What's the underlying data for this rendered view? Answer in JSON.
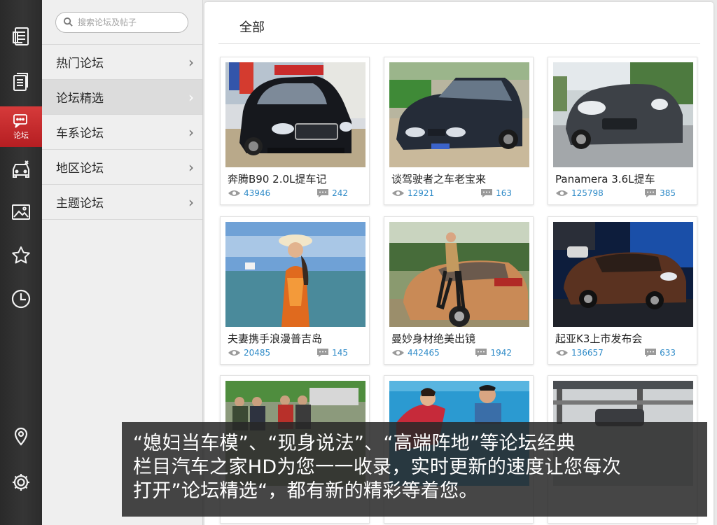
{
  "colors": {
    "accent_red": "#c8262a",
    "link_blue": "#2f8bc8",
    "rail_bg": "#303030"
  },
  "rail": [
    {
      "icon": "news-icon"
    },
    {
      "icon": "document-icon"
    },
    {
      "icon": "forum-icon",
      "label": "论坛",
      "active": true
    },
    {
      "icon": "car-icon"
    },
    {
      "icon": "picture-icon"
    },
    {
      "icon": "star-icon"
    },
    {
      "icon": "clock-icon"
    },
    {
      "icon": "location-icon"
    },
    {
      "icon": "settings-icon"
    }
  ],
  "search": {
    "placeholder": "搜索论坛及帖子"
  },
  "menu": {
    "items": [
      {
        "label": "热门论坛",
        "selected": false
      },
      {
        "label": "论坛精选",
        "selected": true
      },
      {
        "label": "车系论坛",
        "selected": false
      },
      {
        "label": "地区论坛",
        "selected": false
      },
      {
        "label": "主题论坛",
        "selected": false
      }
    ]
  },
  "content": {
    "title": "全部",
    "cards": [
      {
        "title": "奔腾B90 2.0L提车记",
        "views": "43946",
        "replies": "242"
      },
      {
        "title": "谈驾驶者之车老宝来",
        "views": "12921",
        "replies": "163"
      },
      {
        "title": "Panamera 3.6L提车",
        "views": "125798",
        "replies": "385"
      },
      {
        "title": "夫妻携手浪漫普吉岛",
        "views": "20485",
        "replies": "145"
      },
      {
        "title": "曼妙身材绝美出镜",
        "views": "442465",
        "replies": "1942"
      },
      {
        "title": "起亚K3上市发布会",
        "views": "136657",
        "replies": "633"
      }
    ]
  },
  "caption": {
    "lines": [
      "“媳妇当车模”、“现身说法”、“高端阵地”等论坛经典",
      "栏目汽车之家HD为您一一收录，实时更新的速度让您每次",
      "打开”论坛精选“，都有新的精彩等着您。"
    ]
  }
}
